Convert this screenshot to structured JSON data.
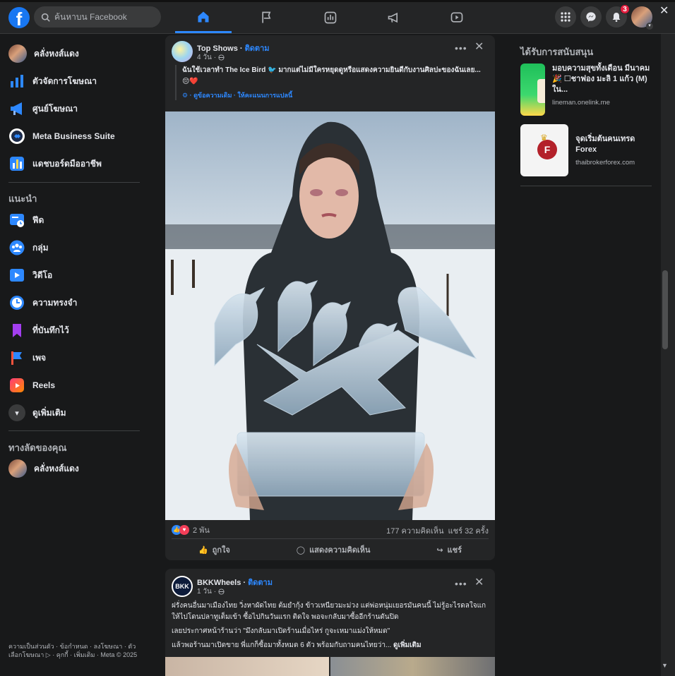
{
  "topbar": {
    "search_placeholder": "ค้นหาบน Facebook",
    "notifications_count": "3"
  },
  "sidebar": {
    "profile_name": "คลั่งหงส์แดง",
    "items_top": [
      "ตัวจัดการโฆษณา",
      "ศูนย์โฆษณา",
      "Meta Business Suite",
      "แดชบอร์ดมืออาชีพ"
    ],
    "recommend_heading": "แนะนำ",
    "items_recommend": [
      "ฟีด",
      "กลุ่ม",
      "วิดีโอ",
      "ความทรงจำ",
      "ที่บันทึกไว้",
      "เพจ",
      "Reels"
    ],
    "see_more": "ดูเพิ่มเติม",
    "shortcuts_heading": "ทางลัดของคุณ",
    "shortcut_name": "คลั่งหงส์แดง",
    "footer": "ความเป็นส่วนตัว · ข้อกำหนด · ลงโฆษณา · ตัวเลือกโฆษณา ▷ · คุกกี้ · เพิ่มเติม · Meta © 2025"
  },
  "post1": {
    "page_name": "Top Shows",
    "follow": "ติดตาม",
    "time": "4 วัน",
    "text": "ฉันใช้เวลาทำ The Ice Bird 🐦 มากแต่ไม่มีใครหยุดดูหรือแสดงความยินดีกับงานศิลปะของฉันเลย... 😔❤️",
    "translate": "⚙ · ดูข้อความเดิม · ให้คะแนนการแปลนี้",
    "reactions": "2 พัน",
    "comments": "177 ความคิดเห็น",
    "shares": "แชร์ 32 ครั้ง",
    "like": "ถูกใจ",
    "comment": "แสดงความคิดเห็น",
    "share": "แชร์"
  },
  "post2": {
    "page_name": "BKKWheels",
    "follow": "ติดตาม",
    "time": "1 วัน",
    "avatar_text": "BKK",
    "p1": "ฝรั่งคนอื่นมาเมืองไทย วิ่งหาผัดไทย ต้มยำกุ้ง ข้าวเหนียวมะม่วง แต่พ่อหนุ่มเยอรมันคนนี้ ไม่รู้อะไรดลใจแกให้ไปโดนปลาทูเต็มเข้า ซื้อไปกินวันแรก ติดใจ พอจะกลับมาซื้ออีกร้านดันปิด",
    "p2": "เลยประกาศหน้าร้านว่า \"มึงกลับมาเปิดร้านเมื่อไหร่ กูจะเหมาแม่งให้หมด\"",
    "p3": "แล้วพอร้านมาเปิดขาย พี่แกก็ซื้อมาทั้งหมด 6 ตัว พร้อมกับถามคนไทยว่า...",
    "see_more": "ดูเพิ่มเติม"
  },
  "right": {
    "heading": "ได้รับการสนับสนุน",
    "ads": [
      {
        "title": "มอบความสุขทั้งเดือน มีนาคม🎉 ☐ชาฟอง มะลิ 1 แก้ว (M) ใน...",
        "url": "lineman.onelink.me"
      },
      {
        "title": "จุดเริ่มต้นคนเทรด Forex",
        "url": "thaibrokerforex.com"
      }
    ]
  },
  "colors": {
    "accent": "#2d88ff",
    "background": "#18191a",
    "card": "#242526",
    "badge": "#e41e3f"
  }
}
